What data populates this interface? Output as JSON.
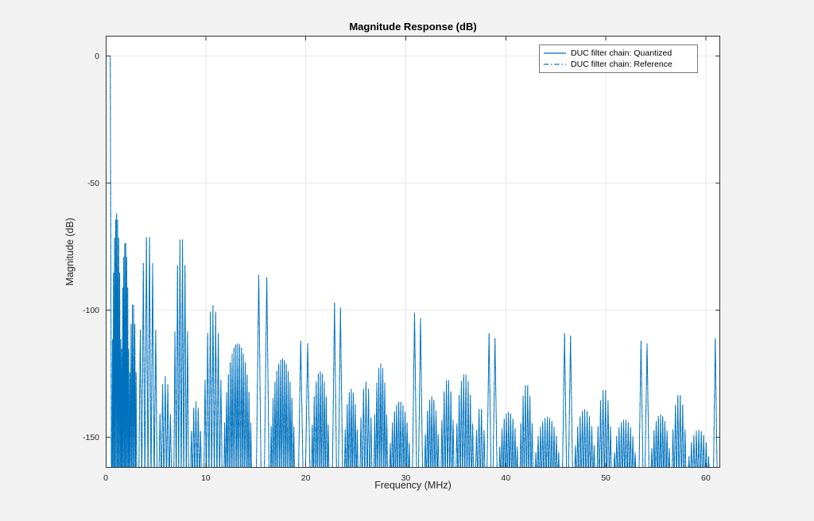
{
  "figure": {
    "background": "#f2f2f2"
  },
  "chart_data": {
    "type": "line",
    "title": "Magnitude Response (dB)",
    "xlabel": "Frequency (MHz)",
    "ylabel": "Magnitude (dB)",
    "xlim": [
      0,
      61.44
    ],
    "ylim": [
      -162,
      8
    ],
    "xticks": [
      0,
      10,
      20,
      30,
      40,
      50,
      60
    ],
    "yticks": [
      0,
      -50,
      -100,
      -150
    ],
    "grid": true,
    "colors": {
      "figure_bg": "#f2f2f2",
      "axes_bg": "#ffffff",
      "grid": "#e8e8e8",
      "axis": "#333333",
      "text": "#262626",
      "line": "#0072BD"
    },
    "legend": {
      "position": "top-right",
      "entries": [
        {
          "label": "DUC filter chain: Quantized",
          "line": "solid",
          "color": "#0072BD"
        },
        {
          "label": "DUC filter chain: Reference",
          "line": "dash-dot",
          "color": "#0072BD"
        }
      ]
    },
    "null_floor_db": -170,
    "envelope_peaks": [
      {
        "x": 0.5,
        "db": 0
      },
      {
        "x": 1.0,
        "db": -62
      },
      {
        "x": 1.9,
        "db": -73
      },
      {
        "x": 4.2,
        "db": -70
      },
      {
        "x": 7.6,
        "db": -71
      },
      {
        "x": 10.9,
        "db": -98
      },
      {
        "x": 13.2,
        "db": -113
      },
      {
        "x": 15.3,
        "db": -86
      },
      {
        "x": 16.1,
        "db": -87
      },
      {
        "x": 17.6,
        "db": -119
      },
      {
        "x": 19.5,
        "db": -112
      },
      {
        "x": 23.0,
        "db": -97
      },
      {
        "x": 26.0,
        "db": -128
      },
      {
        "x": 27.5,
        "db": -121
      },
      {
        "x": 31.0,
        "db": -101
      },
      {
        "x": 34.2,
        "db": -127
      },
      {
        "x": 35.9,
        "db": -125
      },
      {
        "x": 38.6,
        "db": -109
      },
      {
        "x": 42.0,
        "db": -129
      },
      {
        "x": 46.1,
        "db": -109
      },
      {
        "x": 49.8,
        "db": -131
      },
      {
        "x": 53.8,
        "db": -112
      },
      {
        "x": 57.3,
        "db": -133
      },
      {
        "x": 61.0,
        "db": -111
      }
    ],
    "series": [
      {
        "name": "DUC filter chain: Quantized",
        "style": "solid",
        "passband": {
          "x0": 0,
          "x1": 0.45,
          "level_db": 0,
          "drop_x": 0.57
        },
        "segments": [
          {
            "type": "lobe",
            "x0": 0.62,
            "x1": 1.55,
            "peak": -62,
            "ripples": 9
          },
          {
            "type": "lobe",
            "x0": 1.55,
            "x1": 2.35,
            "peak": -73,
            "ripples": 8
          },
          {
            "type": "lobe",
            "x0": 2.35,
            "x1": 3.1,
            "peak": -97,
            "ripples": 6
          },
          {
            "type": "lobe",
            "x0": 3.3,
            "x1": 5.15,
            "peak": -70,
            "ripples": 6
          },
          {
            "type": "lobe",
            "x0": 5.3,
            "x1": 6.6,
            "peak": -126,
            "ripples": 5
          },
          {
            "type": "lobe",
            "x0": 6.8,
            "x1": 8.3,
            "peak": -71,
            "ripples": 6
          },
          {
            "type": "lobe",
            "x0": 8.45,
            "x1": 9.6,
            "peak": -136,
            "ripples": 5
          },
          {
            "type": "lobe",
            "x0": 9.8,
            "x1": 11.65,
            "peak": -98,
            "ripples": 7
          },
          {
            "type": "lobe",
            "x0": 11.8,
            "x1": 14.6,
            "peak": -113,
            "ripples": 15
          },
          {
            "type": "spike",
            "x0": 15.05,
            "x1": 15.55,
            "peak": -86
          },
          {
            "type": "spike",
            "x0": 15.85,
            "x1": 16.35,
            "peak": -87
          },
          {
            "type": "lobe",
            "x0": 16.45,
            "x1": 18.9,
            "peak": -119,
            "ripples": 13
          },
          {
            "type": "spike",
            "x0": 19.25,
            "x1": 19.75,
            "peak": -112
          },
          {
            "type": "spike",
            "x0": 19.95,
            "x1": 20.45,
            "peak": -113
          },
          {
            "type": "lobe",
            "x0": 20.55,
            "x1": 22.35,
            "peak": -124,
            "ripples": 9
          },
          {
            "type": "spike",
            "x0": 22.65,
            "x1": 23.1,
            "peak": -97
          },
          {
            "type": "spike",
            "x0": 23.25,
            "x1": 23.7,
            "peak": -99
          },
          {
            "type": "lobe",
            "x0": 23.85,
            "x1": 25.25,
            "peak": -131,
            "ripples": 7
          },
          {
            "type": "lobe",
            "x0": 25.4,
            "x1": 26.65,
            "peak": -128,
            "ripples": 5
          },
          {
            "type": "lobe",
            "x0": 26.8,
            "x1": 28.2,
            "peak": -121,
            "ripples": 7
          },
          {
            "type": "lobe",
            "x0": 28.35,
            "x1": 30.45,
            "peak": -136,
            "ripples": 10
          },
          {
            "type": "spike",
            "x0": 30.65,
            "x1": 31.1,
            "peak": -101
          },
          {
            "type": "spike",
            "x0": 31.25,
            "x1": 31.7,
            "peak": -103
          },
          {
            "type": "lobe",
            "x0": 31.85,
            "x1": 33.35,
            "peak": -134,
            "ripples": 7
          },
          {
            "type": "lobe",
            "x0": 33.5,
            "x1": 34.85,
            "peak": -127,
            "ripples": 6
          },
          {
            "type": "lobe",
            "x0": 35.0,
            "x1": 36.8,
            "peak": -125,
            "ripples": 8
          },
          {
            "type": "lobe",
            "x0": 36.95,
            "x1": 37.95,
            "peak": -138,
            "ripples": 4
          },
          {
            "type": "spike",
            "x0": 38.1,
            "x1": 38.55,
            "peak": -109
          },
          {
            "type": "spike",
            "x0": 38.7,
            "x1": 39.15,
            "peak": -111
          },
          {
            "type": "lobe",
            "x0": 39.3,
            "x1": 41.25,
            "peak": -140,
            "ripples": 9
          },
          {
            "type": "lobe",
            "x0": 41.4,
            "x1": 42.75,
            "peak": -129,
            "ripples": 6
          },
          {
            "type": "lobe",
            "x0": 42.9,
            "x1": 45.4,
            "peak": -142,
            "ripples": 11
          },
          {
            "type": "spike",
            "x0": 45.65,
            "x1": 46.1,
            "peak": -109
          },
          {
            "type": "spike",
            "x0": 46.25,
            "x1": 46.7,
            "peak": -110
          },
          {
            "type": "lobe",
            "x0": 46.85,
            "x1": 48.95,
            "peak": -139,
            "ripples": 9
          },
          {
            "type": "lobe",
            "x0": 49.1,
            "x1": 50.6,
            "peak": -131,
            "ripples": 6
          },
          {
            "type": "lobe",
            "x0": 50.75,
            "x1": 53.05,
            "peak": -143,
            "ripples": 10
          },
          {
            "type": "spike",
            "x0": 53.3,
            "x1": 53.75,
            "peak": -112
          },
          {
            "type": "spike",
            "x0": 53.9,
            "x1": 54.35,
            "peak": -113
          },
          {
            "type": "lobe",
            "x0": 54.5,
            "x1": 56.45,
            "peak": -141,
            "ripples": 9
          },
          {
            "type": "lobe",
            "x0": 56.6,
            "x1": 58.05,
            "peak": -133,
            "ripples": 6
          },
          {
            "type": "lobe",
            "x0": 58.2,
            "x1": 60.4,
            "peak": -147,
            "ripples": 9
          },
          {
            "type": "spike",
            "x0": 60.75,
            "x1": 61.15,
            "peak": -111
          }
        ]
      },
      {
        "name": "DUC filter chain: Reference",
        "style": "dash-dot",
        "overlaps_quantized": true
      }
    ]
  }
}
